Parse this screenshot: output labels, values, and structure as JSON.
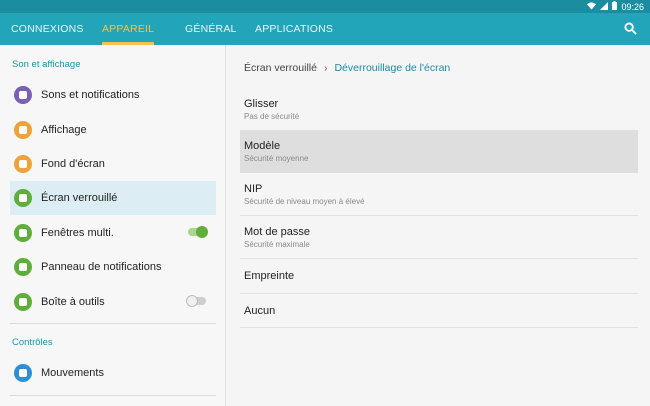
{
  "status": {
    "time": "09:26"
  },
  "tabs": [
    {
      "label": "CONNEXIONS"
    },
    {
      "label": "APPAREIL"
    },
    {
      "label": "GÉNÉRAL"
    },
    {
      "label": "APPLICATIONS"
    }
  ],
  "sidebar": {
    "section1": "Son et affichage",
    "items": [
      {
        "label": "Sons et notifications",
        "color": "#7b5fb5"
      },
      {
        "label": "Affichage",
        "color": "#f0a23a"
      },
      {
        "label": "Fond d'écran",
        "color": "#f0a23a"
      },
      {
        "label": "Écran verrouillé",
        "color": "#5fae3c"
      },
      {
        "label": "Fenêtres multi.",
        "color": "#5fae3c"
      },
      {
        "label": "Panneau de notifications",
        "color": "#5fae3c"
      },
      {
        "label": "Boîte à outils",
        "color": "#5fae3c"
      }
    ],
    "section2": "Contrôles",
    "items2": [
      {
        "label": "Mouvements",
        "color": "#2e8fd8"
      }
    ]
  },
  "breadcrumb": {
    "parent": "Écran verrouillé",
    "current": "Déverrouillage de l'écran"
  },
  "options": [
    {
      "title": "Glisser",
      "sub": "Pas de sécurité"
    },
    {
      "title": "Modèle",
      "sub": "Sécurité moyenne"
    },
    {
      "title": "NIP",
      "sub": "Sécurité de niveau moyen à élevé"
    },
    {
      "title": "Mot de passe",
      "sub": "Sécurité maximale"
    },
    {
      "title": "Empreinte",
      "sub": ""
    },
    {
      "title": "Aucun",
      "sub": ""
    }
  ],
  "colors": {
    "accent": "#22a5b8",
    "active_tab": "#f5c24a",
    "toggle_on": "#5fae3c"
  }
}
